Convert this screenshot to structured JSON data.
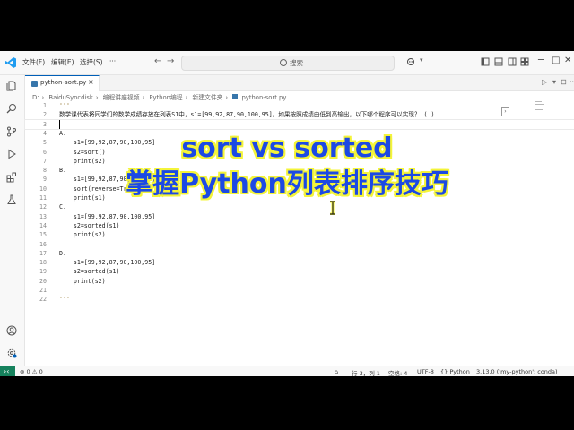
{
  "menu": {
    "file": "文件(F)",
    "edit": "编辑(E)",
    "select": "选择(S)",
    "more": "···"
  },
  "search": {
    "text": "搜索"
  },
  "tab": {
    "label": "python-sort.py"
  },
  "breadcrumb": [
    "D:",
    "BaiduSyncdisk",
    "编程讲座视频",
    "Python编程",
    "新建文件夹",
    "python-sort.py"
  ],
  "editor": {
    "lines": [
      {
        "n": "1",
        "t": "'''"
      },
      {
        "n": "2",
        "t": "数学课代表将同学们的数学成绩存放在列表S1中，s1=[99,92,87,90,100,95]。如果按照成绩由低到高输出，以下哪个程序可以实现？ ( )"
      },
      {
        "n": "3",
        "t": ""
      },
      {
        "n": "4",
        "t": "A."
      },
      {
        "n": "5",
        "t": "    s1=[99,92,87,90,100,95]"
      },
      {
        "n": "6",
        "t": "    s2=sort()"
      },
      {
        "n": "7",
        "t": "    print(s2)"
      },
      {
        "n": "8",
        "t": "B."
      },
      {
        "n": "9",
        "t": "    s1=[99,92,87,90,100,95]"
      },
      {
        "n": "10",
        "t": "    sort(reverse=True)"
      },
      {
        "n": "11",
        "t": "    print(s1)"
      },
      {
        "n": "12",
        "t": "C."
      },
      {
        "n": "13",
        "t": "    s1=[99,92,87,90,100,95]"
      },
      {
        "n": "14",
        "t": "    s2=sorted(s1)"
      },
      {
        "n": "15",
        "t": "    print(s2)"
      },
      {
        "n": "16",
        "t": ""
      },
      {
        "n": "17",
        "t": "D."
      },
      {
        "n": "18",
        "t": "    s1=[99,92,87,90,100,95]"
      },
      {
        "n": "19",
        "t": "    s2=sorted(s1)"
      },
      {
        "n": "20",
        "t": "    print(s2)"
      },
      {
        "n": "21",
        "t": ""
      },
      {
        "n": "22",
        "t": "'''"
      }
    ]
  },
  "overlay": {
    "line1": "sort vs sorted",
    "line2": "掌握Python列表排序技巧"
  },
  "status": {
    "errors": "⊗ 0 ⚠ 0",
    "bell": "🔔",
    "position": "行 3，列 1",
    "spaces": "空格: 4",
    "encoding": "UTF-8",
    "lang": "{} Python",
    "interpreter": "3.13.0 ('my-python': conda)"
  },
  "colors": {
    "overlay_text": "#1c49e4",
    "overlay_outline": "#f4f43a",
    "accent": "#005fb8",
    "remote": "#16825d"
  }
}
